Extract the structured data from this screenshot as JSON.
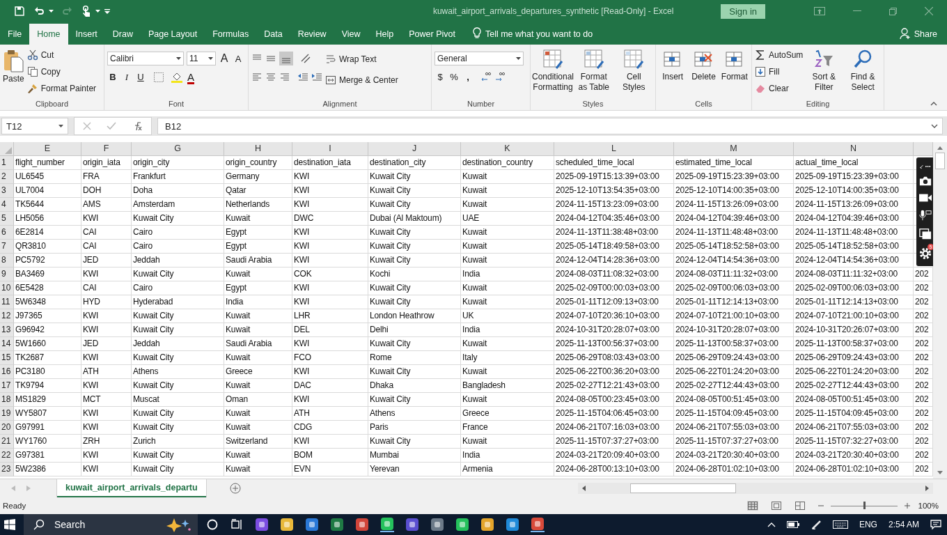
{
  "window": {
    "title": "kuwait_airport_arrivals_departures_synthetic  [Read-Only]  -  Excel",
    "sign_in": "Sign in"
  },
  "menu": {
    "tabs": [
      {
        "label": "File",
        "selected": false
      },
      {
        "label": "Home",
        "selected": true
      },
      {
        "label": "Insert",
        "selected": false
      },
      {
        "label": "Draw",
        "selected": false
      },
      {
        "label": "Page Layout",
        "selected": false
      },
      {
        "label": "Formulas",
        "selected": false
      },
      {
        "label": "Data",
        "selected": false
      },
      {
        "label": "Review",
        "selected": false
      },
      {
        "label": "View",
        "selected": false
      },
      {
        "label": "Help",
        "selected": false
      },
      {
        "label": "Power Pivot",
        "selected": false
      }
    ],
    "tell_me": "Tell me what you want to do",
    "share": "Share"
  },
  "ribbon": {
    "clipboard": {
      "paste": "Paste",
      "cut": "Cut",
      "copy": "Copy",
      "format_painter": "Format Painter",
      "label": "Clipboard"
    },
    "font": {
      "font_name": "Calibri",
      "font_size": "11",
      "grow": "A",
      "shrink": "A",
      "bold": "B",
      "italic": "I",
      "underline": "U",
      "font_color": "A",
      "label": "Font"
    },
    "alignment": {
      "wrap_text": "Wrap Text",
      "merge_center": "Merge & Center",
      "label": "Alignment"
    },
    "number": {
      "format": "General",
      "currency": "$",
      "percent": "%",
      "comma": ",",
      "label": "Number"
    },
    "styles": {
      "buttons": [
        "Conditional Formatting",
        "Format as Table",
        "Cell Styles"
      ],
      "label": "Styles"
    },
    "cells": {
      "buttons": [
        "Insert",
        "Delete",
        "Format"
      ],
      "label": "Cells"
    },
    "editing": {
      "autosum": "AutoSum",
      "fill": "Fill",
      "clear": "Clear",
      "sort_filter": "Sort & Filter",
      "find_select": "Find & Select",
      "label": "Editing"
    }
  },
  "formula_bar": {
    "name_box": "T12",
    "formula": "B12"
  },
  "sheet": {
    "columns": [
      "E",
      "F",
      "G",
      "H",
      "I",
      "J",
      "K",
      "L",
      "M",
      "N"
    ],
    "rows": [
      {
        "row": "1",
        "cells": [
          "flight_number",
          "origin_iata",
          "origin_city",
          "origin_country",
          "destination_iata",
          "destination_city",
          "destination_country",
          "scheduled_time_local",
          "estimated_time_local",
          "actual_time_local"
        ]
      },
      {
        "row": "2",
        "cells": [
          "UL6545",
          "FRA",
          "Frankfurt",
          "Germany",
          "KWI",
          "Kuwait City",
          "Kuwait",
          "2025-09-19T15:13:39+03:00",
          "2025-09-19T15:23:39+03:00",
          "2025-09-19T15:23:39+03:00"
        ]
      },
      {
        "row": "3",
        "cells": [
          "UL7004",
          "DOH",
          "Doha",
          "Qatar",
          "KWI",
          "Kuwait City",
          "Kuwait",
          "2025-12-10T13:54:35+03:00",
          "2025-12-10T14:00:35+03:00",
          "2025-12-10T14:00:35+03:00"
        ]
      },
      {
        "row": "4",
        "cells": [
          "TK5644",
          "AMS",
          "Amsterdam",
          "Netherlands",
          "KWI",
          "Kuwait City",
          "Kuwait",
          "2024-11-15T13:23:09+03:00",
          "2024-11-15T13:26:09+03:00",
          "2024-11-15T13:26:09+03:00"
        ]
      },
      {
        "row": "5",
        "cells": [
          "LH5056",
          "KWI",
          "Kuwait City",
          "Kuwait",
          "DWC",
          "Dubai (Al Maktoum)",
          "UAE",
          "2024-04-12T04:35:46+03:00",
          "2024-04-12T04:39:46+03:00",
          "2024-04-12T04:39:46+03:00"
        ]
      },
      {
        "row": "6",
        "cells": [
          "6E2814",
          "CAI",
          "Cairo",
          "Egypt",
          "KWI",
          "Kuwait City",
          "Kuwait",
          "2024-11-13T11:38:48+03:00",
          "2024-11-13T11:48:48+03:00",
          "2024-11-13T11:48:48+03:00"
        ]
      },
      {
        "row": "7",
        "cells": [
          "QR3810",
          "CAI",
          "Cairo",
          "Egypt",
          "KWI",
          "Kuwait City",
          "Kuwait",
          "2025-05-14T18:49:58+03:00",
          "2025-05-14T18:52:58+03:00",
          "2025-05-14T18:52:58+03:00"
        ]
      },
      {
        "row": "8",
        "cells": [
          "PC5792",
          "JED",
          "Jeddah",
          "Saudi Arabia",
          "KWI",
          "Kuwait City",
          "Kuwait",
          "2024-12-04T14:28:36+03:00",
          "2024-12-04T14:54:36+03:00",
          "2024-12-04T14:54:36+03:00"
        ]
      },
      {
        "row": "9",
        "cells": [
          "BA3469",
          "KWI",
          "Kuwait City",
          "Kuwait",
          "COK",
          "Kochi",
          "India",
          "2024-08-03T11:08:32+03:00",
          "2024-08-03T11:11:32+03:00",
          "2024-08-03T11:11:32+03:00"
        ],
        "cut_cell": "202"
      },
      {
        "row": "10",
        "cells": [
          "6E5428",
          "CAI",
          "Cairo",
          "Egypt",
          "KWI",
          "Kuwait City",
          "Kuwait",
          "2025-02-09T00:00:03+03:00",
          "2025-02-09T00:06:03+03:00",
          "2025-02-09T00:06:03+03:00"
        ],
        "cut_cell": "202"
      },
      {
        "row": "11",
        "cells": [
          "5W6348",
          "HYD",
          "Hyderabad",
          "India",
          "KWI",
          "Kuwait City",
          "Kuwait",
          "2025-01-11T12:09:13+03:00",
          "2025-01-11T12:14:13+03:00",
          "2025-01-11T12:14:13+03:00"
        ],
        "cut_cell": "202"
      },
      {
        "row": "12",
        "cells": [
          "J97365",
          "KWI",
          "Kuwait City",
          "Kuwait",
          "LHR",
          "London Heathrow",
          "UK",
          "2024-07-10T20:36:10+03:00",
          "2024-07-10T21:00:10+03:00",
          "2024-07-10T21:00:10+03:00"
        ],
        "cut_cell": "202"
      },
      {
        "row": "13",
        "cells": [
          "G96942",
          "KWI",
          "Kuwait City",
          "Kuwait",
          "DEL",
          "Delhi",
          "India",
          "2024-10-31T20:28:07+03:00",
          "2024-10-31T20:28:07+03:00",
          "2024-10-31T20:26:07+03:00"
        ],
        "cut_cell": "202"
      },
      {
        "row": "14",
        "cells": [
          "5W1660",
          "JED",
          "Jeddah",
          "Saudi Arabia",
          "KWI",
          "Kuwait City",
          "Kuwait",
          "2025-11-13T00:56:37+03:00",
          "2025-11-13T00:58:37+03:00",
          "2025-11-13T00:58:37+03:00"
        ],
        "cut_cell": "202"
      },
      {
        "row": "15",
        "cells": [
          "TK2687",
          "KWI",
          "Kuwait City",
          "Kuwait",
          "FCO",
          "Rome",
          "Italy",
          "2025-06-29T08:03:43+03:00",
          "2025-06-29T09:24:43+03:00",
          "2025-06-29T09:24:43+03:00"
        ],
        "cut_cell": "202"
      },
      {
        "row": "16",
        "cells": [
          "PC3180",
          "ATH",
          "Athens",
          "Greece",
          "KWI",
          "Kuwait City",
          "Kuwait",
          "2025-06-22T00:36:20+03:00",
          "2025-06-22T01:24:20+03:00",
          "2025-06-22T01:24:20+03:00"
        ],
        "cut_cell": "202"
      },
      {
        "row": "17",
        "cells": [
          "TK9794",
          "KWI",
          "Kuwait City",
          "Kuwait",
          "DAC",
          "Dhaka",
          "Bangladesh",
          "2025-02-27T12:21:43+03:00",
          "2025-02-27T12:44:43+03:00",
          "2025-02-27T12:44:43+03:00"
        ],
        "cut_cell": "202"
      },
      {
        "row": "18",
        "cells": [
          "MS1829",
          "MCT",
          "Muscat",
          "Oman",
          "KWI",
          "Kuwait City",
          "Kuwait",
          "2024-08-05T00:23:45+03:00",
          "2024-08-05T00:51:45+03:00",
          "2024-08-05T00:51:45+03:00"
        ],
        "cut_cell": "202"
      },
      {
        "row": "19",
        "cells": [
          "WY5807",
          "KWI",
          "Kuwait City",
          "Kuwait",
          "ATH",
          "Athens",
          "Greece",
          "2025-11-15T04:06:45+03:00",
          "2025-11-15T04:09:45+03:00",
          "2025-11-15T04:09:45+03:00"
        ],
        "cut_cell": "202"
      },
      {
        "row": "20",
        "cells": [
          "G97991",
          "KWI",
          "Kuwait City",
          "Kuwait",
          "CDG",
          "Paris",
          "France",
          "2024-06-21T07:16:03+03:00",
          "2024-06-21T07:55:03+03:00",
          "2024-06-21T07:55:03+03:00"
        ],
        "cut_cell": "202"
      },
      {
        "row": "21",
        "cells": [
          "WY1760",
          "ZRH",
          "Zurich",
          "Switzerland",
          "KWI",
          "Kuwait City",
          "Kuwait",
          "2025-11-15T07:37:27+03:00",
          "2025-11-15T07:37:27+03:00",
          "2025-11-15T07:32:27+03:00"
        ],
        "cut_cell": "202"
      },
      {
        "row": "22",
        "cells": [
          "G97381",
          "KWI",
          "Kuwait City",
          "Kuwait",
          "BOM",
          "Mumbai",
          "India",
          "2024-03-21T20:09:40+03:00",
          "2024-03-21T20:30:40+03:00",
          "2024-03-21T20:30:40+03:00"
        ],
        "cut_cell": "202"
      },
      {
        "row": "23",
        "cells": [
          "5W2386",
          "KWI",
          "Kuwait City",
          "Kuwait",
          "EVN",
          "Yerevan",
          "Armenia",
          "2024-06-28T00:13:10+03:00",
          "2024-06-28T01:02:10+03:00",
          "2024-06-28T01:02:10+03:00"
        ],
        "cut_cell": "202"
      }
    ]
  },
  "recorder": {
    "badge": "5"
  },
  "sheet_tabs": [
    {
      "label": "kuwait_airport_arrivals_departu",
      "selected": true
    }
  ],
  "status_bar": {
    "status": "Ready",
    "zoom": "100%",
    "zoom_slider": {
      "level": 0.5
    }
  },
  "taskbar": {
    "search": "Search",
    "language": "ENG",
    "time": "2:54 AM"
  }
}
